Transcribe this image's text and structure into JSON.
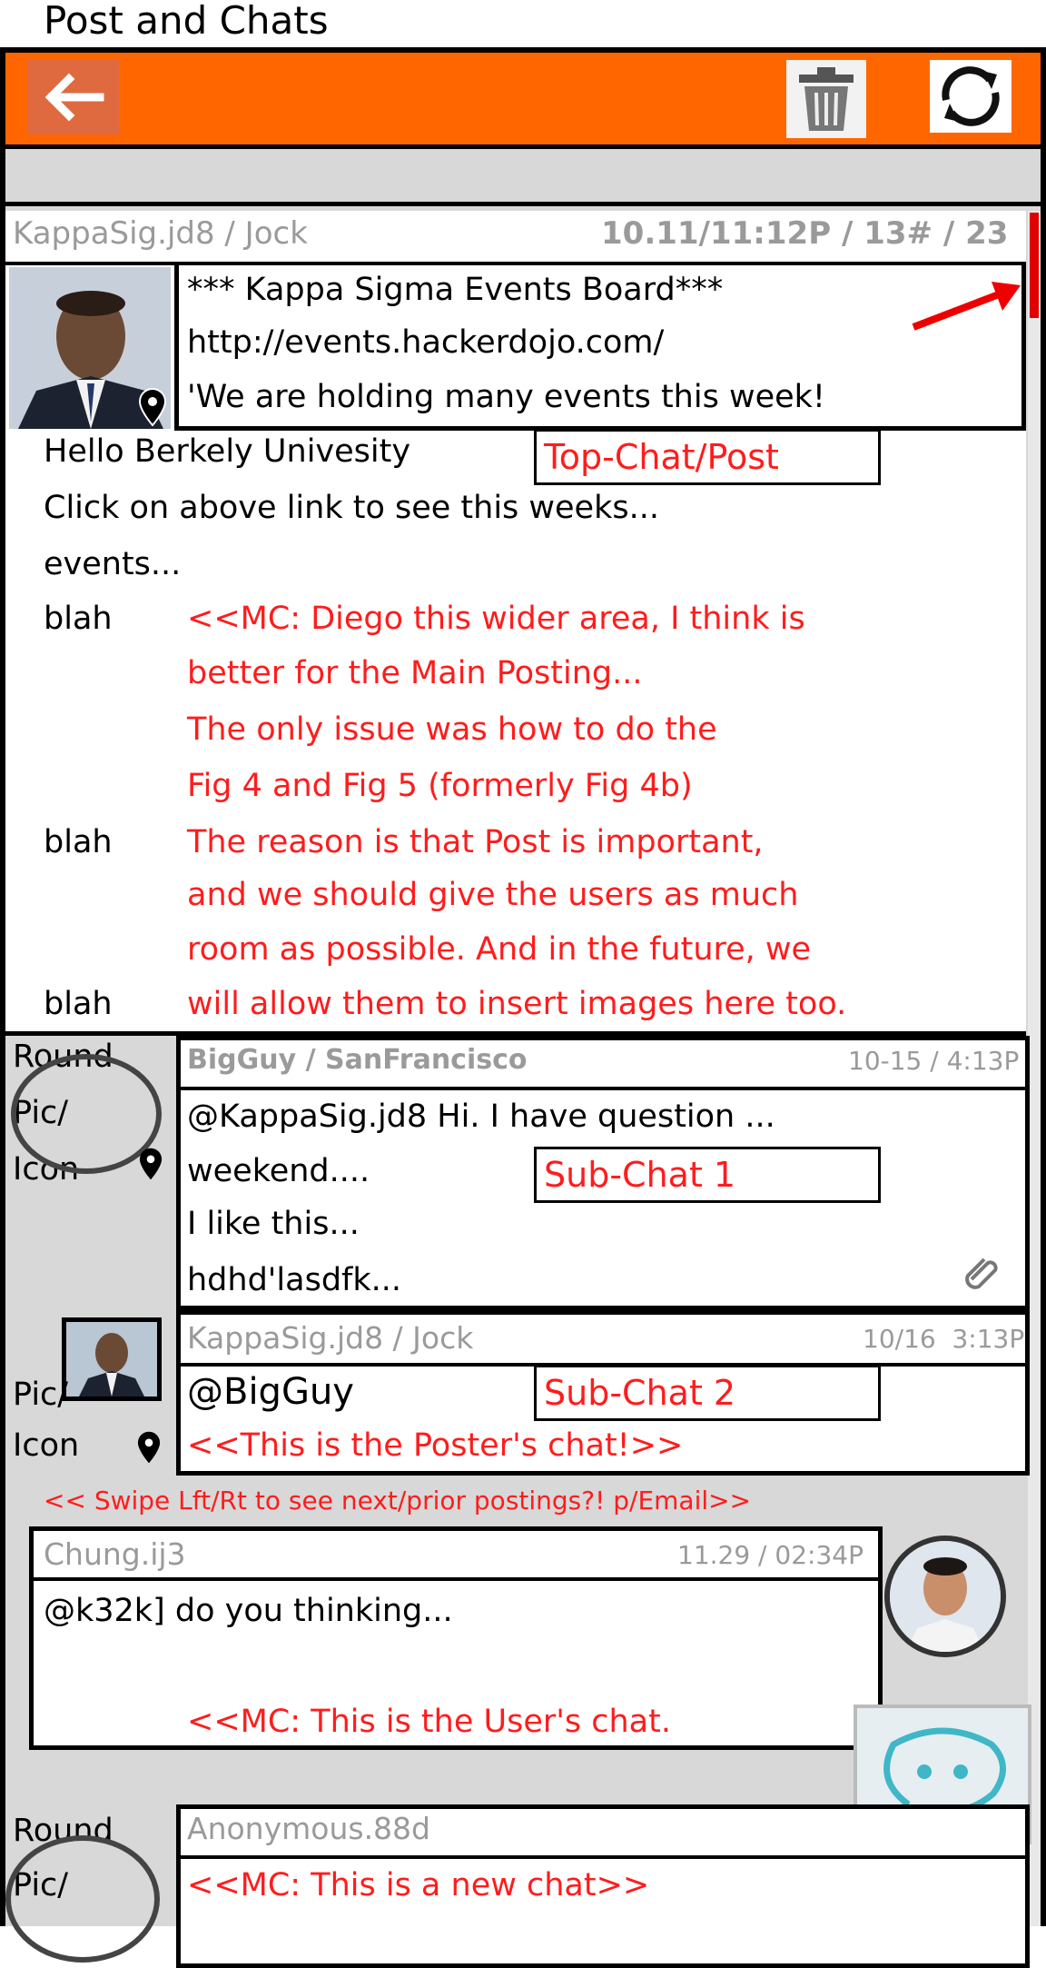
{
  "page_title": "Post and Chats",
  "colors": {
    "header": "#ff6600",
    "annotation_red": "#ff1c1c"
  },
  "toolbar": {
    "back_icon": "arrow-left-icon",
    "delete_icon": "trash-icon",
    "refresh_icon": "refresh-icon"
  },
  "post": {
    "author": "KappaSig.jd8 / Jock",
    "meta": "10.11/11:12P / 13# / 23",
    "lines": [
      "*** Kappa Sigma Events Board***",
      "http://events.hackerdojo.com/",
      "'We are holding many events this week!"
    ],
    "body": [
      "Hello Berkely Univesity",
      "Click on above link to see this weeks...",
      "events..."
    ],
    "label": "Top-Chat/Post",
    "blah": "blah",
    "notes": [
      "<<MC: Diego this wider area, I think is",
      "better for the Main Posting...",
      "The only issue was how to do the",
      "Fig 4 and Fig 5 (formerly Fig 4b)",
      "The reason is that Post is important,",
      "and we should give the users as much",
      "room as possible. And in the future, we",
      "will allow them to insert images here too."
    ]
  },
  "subchat1": {
    "pic_label": [
      "Round",
      "Pic/",
      "Icon"
    ],
    "author": "BigGuy / SanFrancisco",
    "time": "10-15 / 4:13P",
    "lines": [
      "@KappaSig.jd8 Hi. I have question ...",
      "weekend....",
      "I like this...",
      "hdhd'lasdfk..."
    ],
    "label": "Sub-Chat 1"
  },
  "subchat2": {
    "pic_label": [
      "Pic/",
      "Icon"
    ],
    "author": "KappaSig.jd8 / Jock",
    "time": "10/16  3:13P",
    "mention": "@BigGuy",
    "note": "<<This is the Poster's chat!>>",
    "label": "Sub-Chat 2"
  },
  "swipe_note": "<< Swipe Lft/Rt to see next/prior postings?! p/Email>>",
  "user_chat": {
    "author": "Chung.ij3",
    "time": "11.29 / 02:34P",
    "line": "@k32k] do you thinking...",
    "note": "<<MC: This is the User's chat."
  },
  "new_chat": {
    "pic_label": [
      "Round",
      "Pic/"
    ],
    "author": "Anonymous.88d",
    "note": "<<MC: This is a new chat>>"
  }
}
